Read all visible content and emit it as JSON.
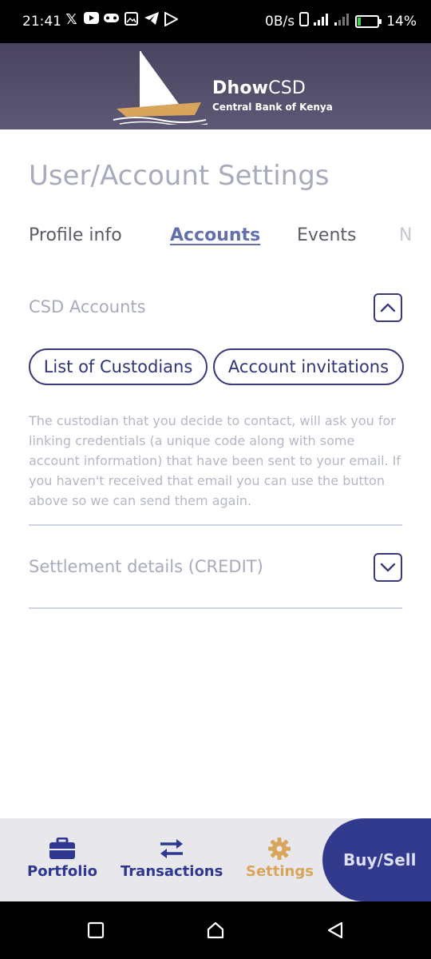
{
  "status_bar": {
    "time": "21:41",
    "left_icons": [
      "x-icon",
      "youtube-icon",
      "game-controller-icon",
      "gallery-icon",
      "telegram-icon",
      "play-store-icon"
    ],
    "network_speed": "0B/s",
    "battery_percent": "14%",
    "battery_level": 0.14
  },
  "header": {
    "brand_bold": "Dhow",
    "brand_light": "CSD",
    "subtitle": "Central Bank of Kenya"
  },
  "page": {
    "title": "User/Account Settings"
  },
  "tabs": [
    {
      "label": "Profile info",
      "active": false
    },
    {
      "label": "Accounts",
      "active": true
    },
    {
      "label": "Events",
      "active": false
    },
    {
      "label": "N",
      "active": false
    }
  ],
  "csd_accounts": {
    "label": "CSD Accounts",
    "expanded": true,
    "buttons": {
      "custodians": "List of Custodians",
      "invitations": "Account invitations"
    },
    "description": "The custodian that you decide to contact, will ask you for linking credentials (a unique code along with some account information) that have been sent to your email. If you haven't received that email you can use the button above so we can send them again."
  },
  "settlement": {
    "label": "Settlement details (CREDIT)",
    "expanded": false
  },
  "bottom_nav": {
    "portfolio": "Portfolio",
    "transactions": "Transactions",
    "settings": "Settings",
    "buy_sell": "Buy/Sell"
  },
  "colors": {
    "header_bg": "#4a4460",
    "primary": "#2f3790",
    "accent_gold": "#d8a55a",
    "muted_text": "#a7abbb",
    "active_tab": "#6470ad"
  }
}
